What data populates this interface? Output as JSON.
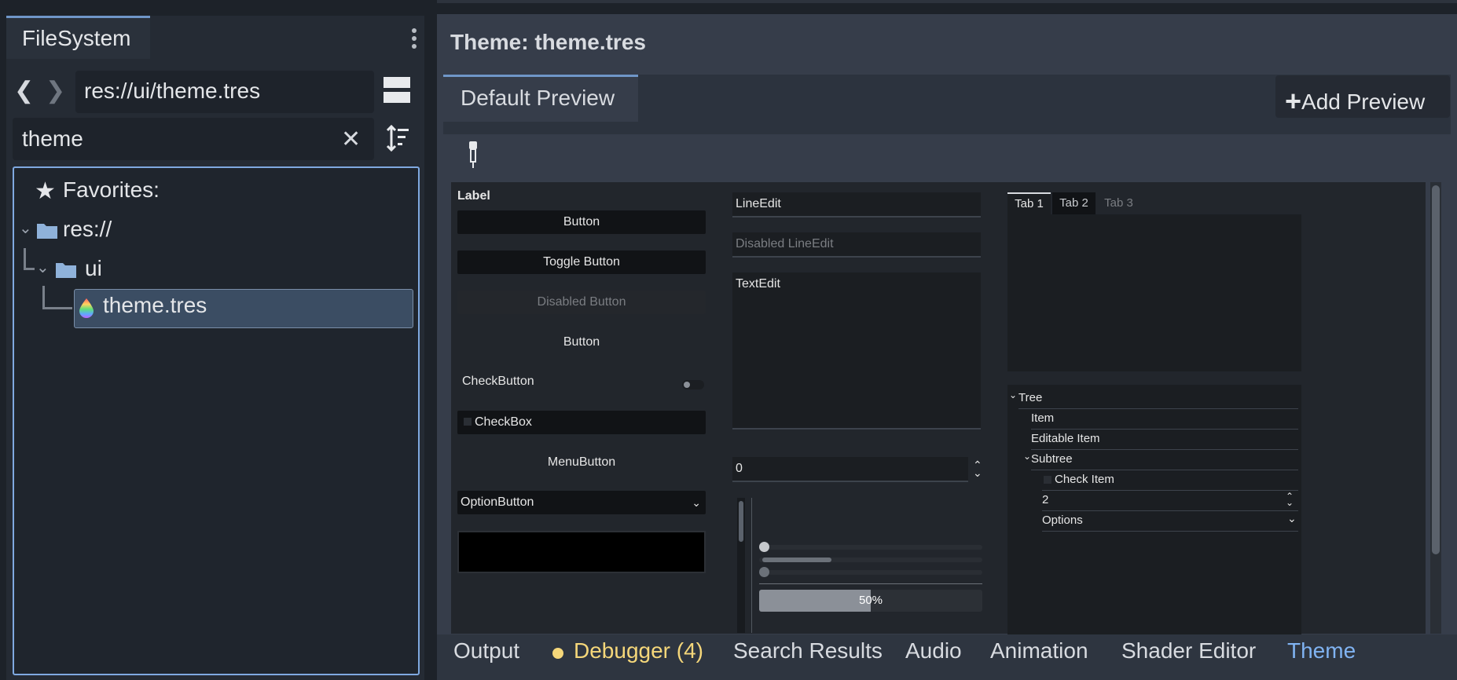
{
  "filesystem": {
    "tab_label": "FileSystem",
    "path": "res://ui/theme.tres",
    "search_value": "theme",
    "favorites_label": "Favorites:",
    "tree": {
      "root": "res://",
      "folder": "ui",
      "file": "theme.tres"
    }
  },
  "editor": {
    "title": "Theme: theme.tres",
    "preview_tab": "Default Preview",
    "add_preview": "Add Preview"
  },
  "preview": {
    "label": "Label",
    "button1": "Button",
    "toggle_button": "Toggle Button",
    "disabled_button": "Disabled Button",
    "button_flat": "Button",
    "check_button": "CheckButton",
    "check_box": "CheckBox",
    "menu_button": "MenuButton",
    "option_button": "OptionButton",
    "line_edit": "LineEdit",
    "disabled_line_edit": "Disabled LineEdit",
    "text_edit": "TextEdit",
    "spin_value": "0",
    "progress_label": "50%",
    "progress_value": 0.5,
    "tabs": [
      "Tab 1",
      "Tab 2",
      "Tab 3"
    ],
    "tree": {
      "root": "Tree",
      "item": "Item",
      "editable_item": "Editable Item",
      "subtree": "Subtree",
      "check_item": "Check Item",
      "range_value": "2",
      "options": "Options"
    }
  },
  "bottom_tabs": {
    "output": "Output",
    "debugger": "Debugger (4)",
    "search_results": "Search Results",
    "audio": "Audio",
    "animation": "Animation",
    "shader_editor": "Shader Editor",
    "theme": "Theme"
  },
  "colors": {
    "accent": "#6f96c8",
    "debugger": "#f5d77a",
    "theme_tab": "#80b3f2",
    "selection": "#3b4d63"
  }
}
